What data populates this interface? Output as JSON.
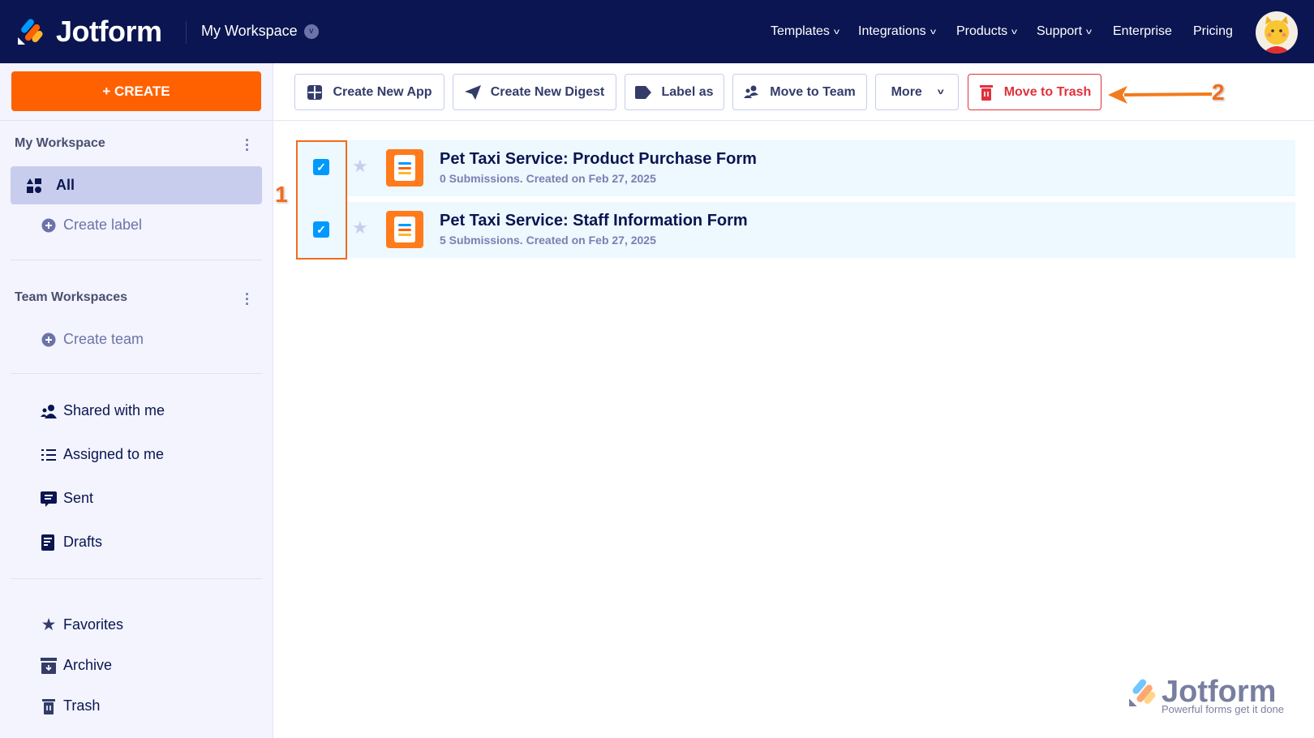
{
  "header": {
    "brand": "Jotform",
    "workspace": "My Workspace",
    "nav": [
      "Templates",
      "Integrations",
      "Products",
      "Support",
      "Enterprise",
      "Pricing"
    ]
  },
  "sidebar": {
    "create_label": "+ CREATE",
    "my_workspace": "My Workspace",
    "all": "All",
    "create_label_item": "Create label",
    "team_workspaces": "Team Workspaces",
    "create_team": "Create team",
    "items": [
      "Shared with me",
      "Assigned to me",
      "Sent",
      "Drafts"
    ],
    "bottom_items": [
      "Favorites",
      "Archive",
      "Trash"
    ]
  },
  "toolbar": {
    "create_app": "Create New App",
    "create_digest": "Create New Digest",
    "label_as": "Label as",
    "move_team": "Move to Team",
    "more": "More",
    "move_trash": "Move to Trash"
  },
  "forms": [
    {
      "title": "Pet Taxi Service: Product Purchase Form",
      "subtitle": "0 Submissions. Created on Feb 27, 2025",
      "checked": true
    },
    {
      "title": "Pet Taxi Service: Staff Information Form",
      "subtitle": "5 Submissions. Created on Feb 27, 2025",
      "checked": true
    }
  ],
  "annotations": {
    "step1": "1",
    "step2": "2"
  },
  "watermark": {
    "brand": "Jotform",
    "tagline": "Powerful forms get it done"
  },
  "colors": {
    "header": "#0a1551",
    "accent": "#ff6100",
    "danger": "#e0313c",
    "checkbox": "#0099ff",
    "annotation": "#f26b1d"
  }
}
